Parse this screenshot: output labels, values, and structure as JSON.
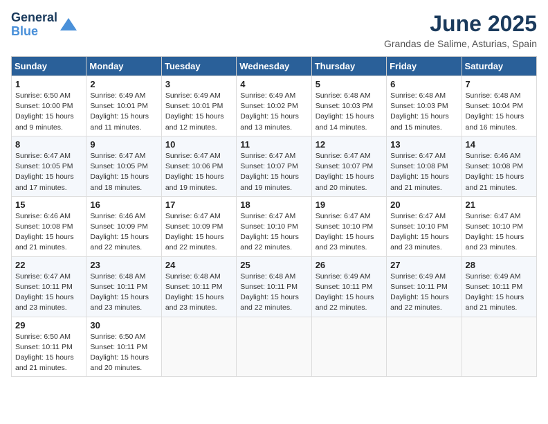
{
  "logo": {
    "line1": "General",
    "line2": "Blue"
  },
  "title": "June 2025",
  "subtitle": "Grandas de Salime, Asturias, Spain",
  "header_days": [
    "Sunday",
    "Monday",
    "Tuesday",
    "Wednesday",
    "Thursday",
    "Friday",
    "Saturday"
  ],
  "weeks": [
    [
      {
        "day": "1",
        "info": "Sunrise: 6:50 AM\nSunset: 10:00 PM\nDaylight: 15 hours\nand 9 minutes."
      },
      {
        "day": "2",
        "info": "Sunrise: 6:49 AM\nSunset: 10:01 PM\nDaylight: 15 hours\nand 11 minutes."
      },
      {
        "day": "3",
        "info": "Sunrise: 6:49 AM\nSunset: 10:01 PM\nDaylight: 15 hours\nand 12 minutes."
      },
      {
        "day": "4",
        "info": "Sunrise: 6:49 AM\nSunset: 10:02 PM\nDaylight: 15 hours\nand 13 minutes."
      },
      {
        "day": "5",
        "info": "Sunrise: 6:48 AM\nSunset: 10:03 PM\nDaylight: 15 hours\nand 14 minutes."
      },
      {
        "day": "6",
        "info": "Sunrise: 6:48 AM\nSunset: 10:03 PM\nDaylight: 15 hours\nand 15 minutes."
      },
      {
        "day": "7",
        "info": "Sunrise: 6:48 AM\nSunset: 10:04 PM\nDaylight: 15 hours\nand 16 minutes."
      }
    ],
    [
      {
        "day": "8",
        "info": "Sunrise: 6:47 AM\nSunset: 10:05 PM\nDaylight: 15 hours\nand 17 minutes."
      },
      {
        "day": "9",
        "info": "Sunrise: 6:47 AM\nSunset: 10:05 PM\nDaylight: 15 hours\nand 18 minutes."
      },
      {
        "day": "10",
        "info": "Sunrise: 6:47 AM\nSunset: 10:06 PM\nDaylight: 15 hours\nand 19 minutes."
      },
      {
        "day": "11",
        "info": "Sunrise: 6:47 AM\nSunset: 10:07 PM\nDaylight: 15 hours\nand 19 minutes."
      },
      {
        "day": "12",
        "info": "Sunrise: 6:47 AM\nSunset: 10:07 PM\nDaylight: 15 hours\nand 20 minutes."
      },
      {
        "day": "13",
        "info": "Sunrise: 6:47 AM\nSunset: 10:08 PM\nDaylight: 15 hours\nand 21 minutes."
      },
      {
        "day": "14",
        "info": "Sunrise: 6:46 AM\nSunset: 10:08 PM\nDaylight: 15 hours\nand 21 minutes."
      }
    ],
    [
      {
        "day": "15",
        "info": "Sunrise: 6:46 AM\nSunset: 10:08 PM\nDaylight: 15 hours\nand 21 minutes."
      },
      {
        "day": "16",
        "info": "Sunrise: 6:46 AM\nSunset: 10:09 PM\nDaylight: 15 hours\nand 22 minutes."
      },
      {
        "day": "17",
        "info": "Sunrise: 6:47 AM\nSunset: 10:09 PM\nDaylight: 15 hours\nand 22 minutes."
      },
      {
        "day": "18",
        "info": "Sunrise: 6:47 AM\nSunset: 10:10 PM\nDaylight: 15 hours\nand 22 minutes."
      },
      {
        "day": "19",
        "info": "Sunrise: 6:47 AM\nSunset: 10:10 PM\nDaylight: 15 hours\nand 23 minutes."
      },
      {
        "day": "20",
        "info": "Sunrise: 6:47 AM\nSunset: 10:10 PM\nDaylight: 15 hours\nand 23 minutes."
      },
      {
        "day": "21",
        "info": "Sunrise: 6:47 AM\nSunset: 10:10 PM\nDaylight: 15 hours\nand 23 minutes."
      }
    ],
    [
      {
        "day": "22",
        "info": "Sunrise: 6:47 AM\nSunset: 10:11 PM\nDaylight: 15 hours\nand 23 minutes."
      },
      {
        "day": "23",
        "info": "Sunrise: 6:48 AM\nSunset: 10:11 PM\nDaylight: 15 hours\nand 23 minutes."
      },
      {
        "day": "24",
        "info": "Sunrise: 6:48 AM\nSunset: 10:11 PM\nDaylight: 15 hours\nand 23 minutes."
      },
      {
        "day": "25",
        "info": "Sunrise: 6:48 AM\nSunset: 10:11 PM\nDaylight: 15 hours\nand 22 minutes."
      },
      {
        "day": "26",
        "info": "Sunrise: 6:49 AM\nSunset: 10:11 PM\nDaylight: 15 hours\nand 22 minutes."
      },
      {
        "day": "27",
        "info": "Sunrise: 6:49 AM\nSunset: 10:11 PM\nDaylight: 15 hours\nand 22 minutes."
      },
      {
        "day": "28",
        "info": "Sunrise: 6:49 AM\nSunset: 10:11 PM\nDaylight: 15 hours\nand 21 minutes."
      }
    ],
    [
      {
        "day": "29",
        "info": "Sunrise: 6:50 AM\nSunset: 10:11 PM\nDaylight: 15 hours\nand 21 minutes."
      },
      {
        "day": "30",
        "info": "Sunrise: 6:50 AM\nSunset: 10:11 PM\nDaylight: 15 hours\nand 20 minutes."
      },
      {
        "day": "",
        "info": ""
      },
      {
        "day": "",
        "info": ""
      },
      {
        "day": "",
        "info": ""
      },
      {
        "day": "",
        "info": ""
      },
      {
        "day": "",
        "info": ""
      }
    ]
  ]
}
